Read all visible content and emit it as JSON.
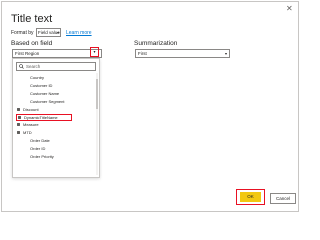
{
  "dialog": {
    "title": "Title text",
    "close_glyph": "✕",
    "format_by_label": "Format by",
    "format_by_value": "Field value",
    "learn_more": "Learn more",
    "based_on_label": "Based on field",
    "based_on_value": "First Region",
    "summarization_label": "Summarization",
    "summarization_value": "First",
    "search_placeholder": "Search",
    "fields": [
      {
        "label": "Country",
        "icon": "none",
        "highlighted": false,
        "indent": true
      },
      {
        "label": "Customer ID",
        "icon": "none",
        "highlighted": false,
        "indent": true
      },
      {
        "label": "Customer Name",
        "icon": "none",
        "highlighted": false,
        "indent": true
      },
      {
        "label": "Customer Segment",
        "icon": "none",
        "highlighted": false,
        "indent": true
      },
      {
        "label": "Discount",
        "icon": "table-icon",
        "highlighted": false,
        "indent": false
      },
      {
        "label": "DynamicTitleName",
        "icon": "table-icon",
        "highlighted": true,
        "indent": false
      },
      {
        "label": "Measure",
        "icon": "table-icon",
        "highlighted": false,
        "indent": false
      },
      {
        "label": "MTD",
        "icon": "table-icon",
        "highlighted": false,
        "indent": false
      },
      {
        "label": "Order Date",
        "icon": "none",
        "highlighted": false,
        "indent": true
      },
      {
        "label": "Order ID",
        "icon": "none",
        "highlighted": false,
        "indent": true
      },
      {
        "label": "Order Priority",
        "icon": "none",
        "highlighted": false,
        "indent": true
      }
    ],
    "ok_label": "OK",
    "cancel_label": "Cancel",
    "colors": {
      "accent": "#f2c811",
      "highlight": "#e81123",
      "link": "#0078d4"
    }
  }
}
